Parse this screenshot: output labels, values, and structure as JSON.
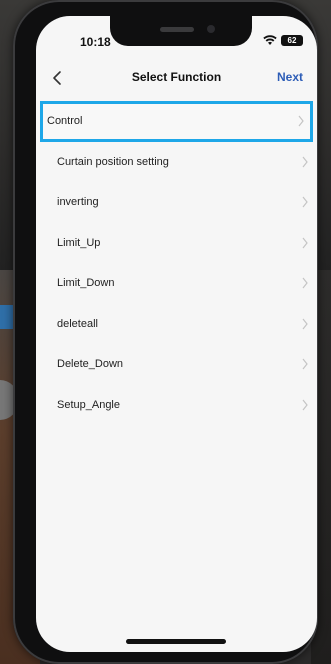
{
  "status": {
    "time": "10:18",
    "battery": "62"
  },
  "nav": {
    "title": "Select Function",
    "next_label": "Next"
  },
  "functions": [
    {
      "label": "Control"
    },
    {
      "label": "Curtain position setting"
    },
    {
      "label": "inverting"
    },
    {
      "label": "Limit_Up"
    },
    {
      "label": "Limit_Down"
    },
    {
      "label": "deleteall"
    },
    {
      "label": "Delete_Down"
    },
    {
      "label": "Setup_Angle"
    }
  ],
  "colors": {
    "accent": "#2d5db7",
    "selection": "#1ea7e8"
  }
}
